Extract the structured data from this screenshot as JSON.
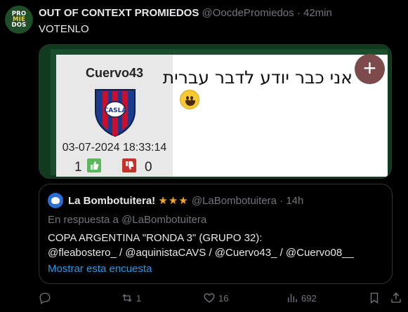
{
  "tweet": {
    "avatar_text": [
      "PRO",
      "MIE",
      "DOS"
    ],
    "author": "OUT OF CONTEXT PROMIEDOS",
    "handle": "@OocdePromiedos",
    "separator": "·",
    "time": "42min",
    "text": "VOTENLO"
  },
  "media": {
    "username": "Cuervo43",
    "datetime": "03-07-2024 18:33:14",
    "likes": "1",
    "dislikes": "0",
    "hebrew_text": "אני כבר יודע לדבר עברית",
    "emoji": "grinning-face",
    "crest_text": "CASLA"
  },
  "quote": {
    "author": "La Bombotuitera!",
    "stars": "★★★",
    "handle": "@LaBombotuitera",
    "separator": "·",
    "time": "14h",
    "reply_prefix": "En respuesta a",
    "reply_handle": "@LaBombotuitera",
    "line1": "COPA ARGENTINA \"RONDA 3\" (GRUPO 32):",
    "line2": "@fleabostero_ / @aquinistaCAVS / @Cuervo43_ / @Cuervo08__",
    "poll_link": "Mostrar esta encuesta"
  },
  "actions": {
    "replies": "",
    "retweets": "1",
    "likes": "16",
    "views": "692"
  },
  "colors": {
    "background": "#000000",
    "text": "#e7e9ea",
    "muted": "#71767b",
    "link": "#1d9bf0",
    "border": "#2f3336",
    "star": "#f4a623"
  }
}
